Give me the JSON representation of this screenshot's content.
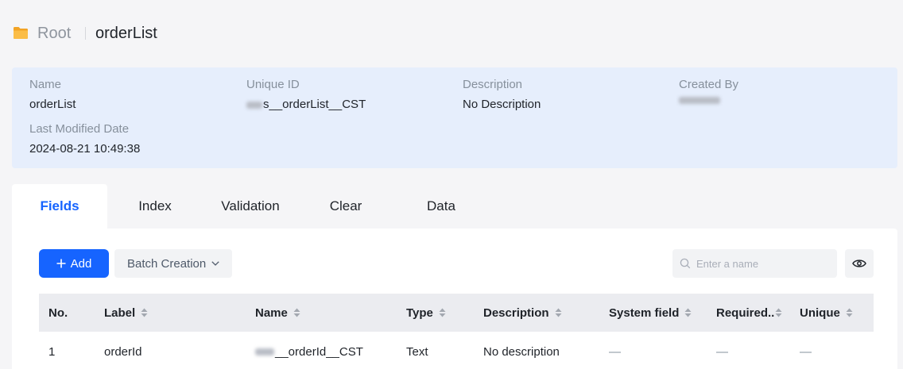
{
  "breadcrumb": {
    "icon": "folder-icon",
    "root_label": "Root",
    "current": "orderList"
  },
  "info": {
    "name_label": "Name",
    "name_value": "orderList",
    "unique_id_label": "Unique ID",
    "unique_id_value": "s__orderList__CST",
    "description_label": "Description",
    "description_value": "No Description",
    "created_by_label": "Created By",
    "last_modified_label": "Last Modified Date",
    "last_modified_value": "2024-08-21 10:49:38"
  },
  "tabs": [
    {
      "label": "Fields",
      "active": true
    },
    {
      "label": "Index",
      "active": false
    },
    {
      "label": "Validation",
      "active": false
    },
    {
      "label": "Clear",
      "active": false
    },
    {
      "label": "Data",
      "active": false
    }
  ],
  "toolbar": {
    "add_icon": "plus-icon",
    "add_label": "Add",
    "batch_label": "Batch Creation",
    "batch_icon": "chevron-down-icon",
    "search_icon": "search-icon",
    "search_placeholder": "Enter a name",
    "visibility_icon": "eye-icon"
  },
  "table": {
    "sort_icon": "sort-icon",
    "columns": [
      {
        "label": "No.",
        "sortable": false
      },
      {
        "label": "Label",
        "sortable": true
      },
      {
        "label": "Name",
        "sortable": true
      },
      {
        "label": "Type",
        "sortable": true
      },
      {
        "label": "Description",
        "sortable": true
      },
      {
        "label": "System field",
        "sortable": true
      },
      {
        "label": "Required..",
        "sortable": true
      },
      {
        "label": "Unique",
        "sortable": true
      }
    ],
    "rows": [
      {
        "cells": [
          "1",
          "orderId",
          "__orderId__CST",
          "Text",
          "No description",
          "—",
          "—",
          "—"
        ]
      }
    ]
  },
  "colors": {
    "accent": "#1664ff",
    "page_bg": "#f5f5f7",
    "info_panel_bg": "#e6eefc",
    "table_header_bg": "#ebecf0",
    "folder": "#f7b23b"
  }
}
